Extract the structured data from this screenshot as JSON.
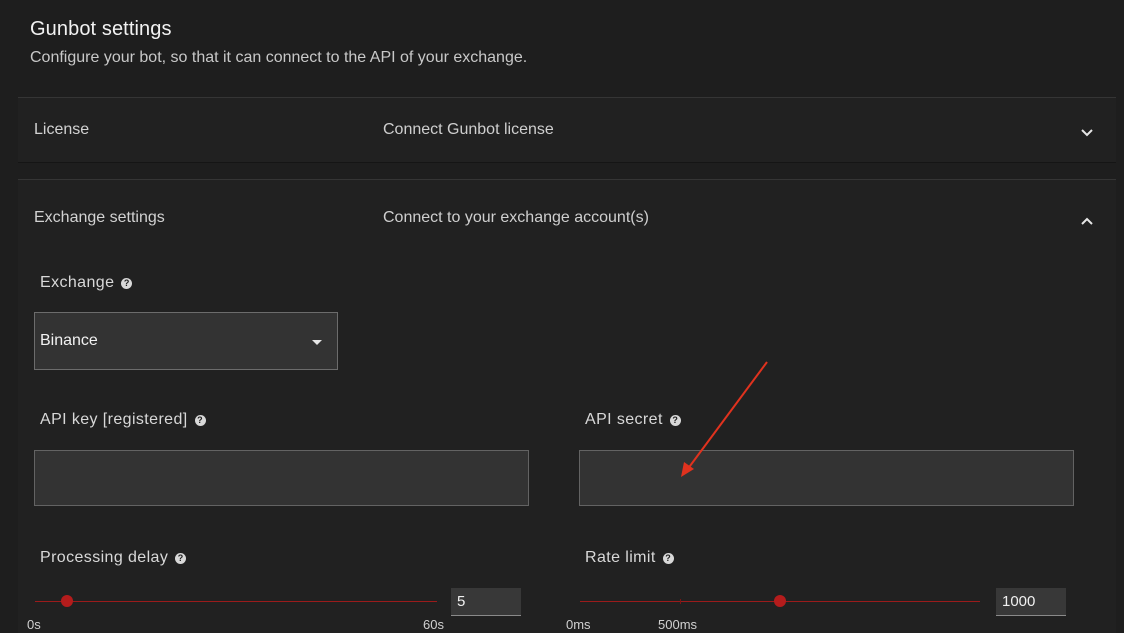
{
  "header": {
    "title": "Gunbot settings",
    "subtitle": "Configure your bot, so that it can connect to the API of your exchange."
  },
  "panels": {
    "license": {
      "name": "License",
      "description": "Connect Gunbot license",
      "expanded": false,
      "icon": "chevron-down-icon"
    },
    "exchange": {
      "name": "Exchange settings",
      "description": "Connect to your exchange account(s)",
      "expanded": true,
      "icon": "chevron-up-icon"
    }
  },
  "form": {
    "exchange": {
      "label": "Exchange",
      "selected": "Binance"
    },
    "api_key": {
      "label": "API key [registered]",
      "value": ""
    },
    "api_secret": {
      "label": "API secret",
      "value": ""
    },
    "processing_delay": {
      "label": "Processing delay",
      "value": "5",
      "slider_fraction": 0.08,
      "min_label": "0s",
      "max_label": "60s"
    },
    "rate_limit": {
      "label": "Rate limit",
      "value": "1000",
      "slider_fraction": 0.5,
      "mark_fraction": 0.25,
      "min_label": "0ms",
      "mark_label": "500ms"
    }
  },
  "colors": {
    "background": "#1e1e1e",
    "panel": "#212121",
    "accent": "#b41c1c",
    "annotation_arrow": "#e0321e"
  },
  "icons": {
    "help": "help-circle-icon",
    "dropdown": "caret-down-icon"
  }
}
